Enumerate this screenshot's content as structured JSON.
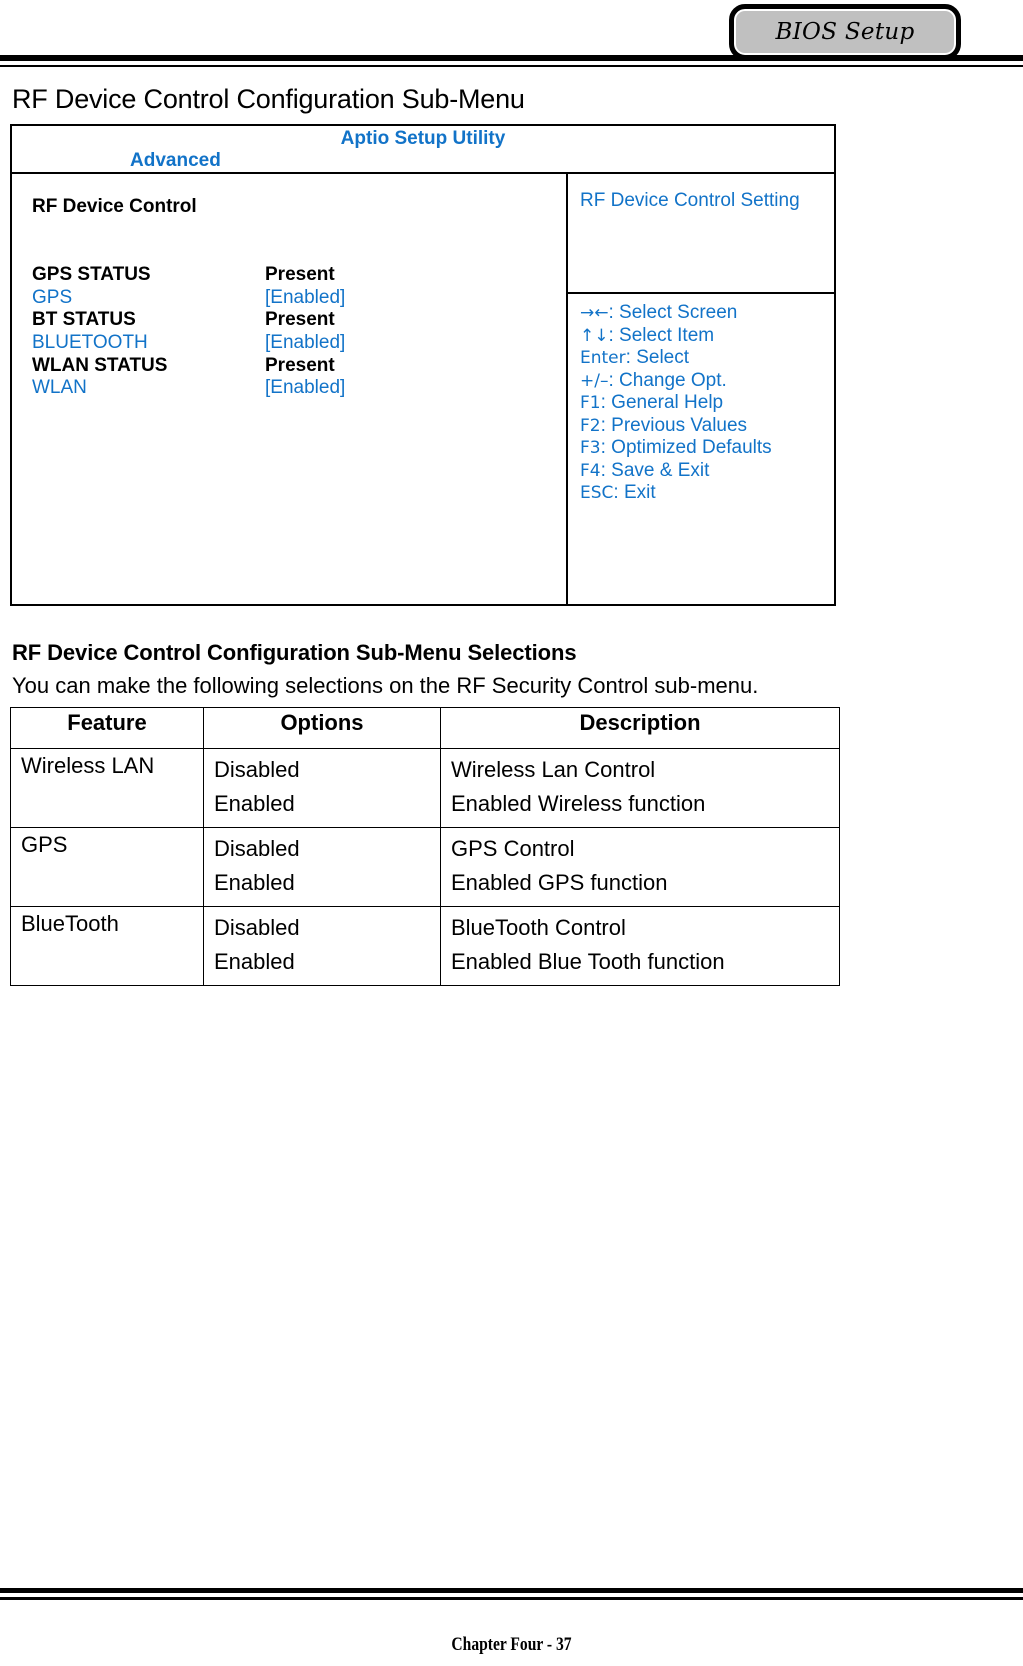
{
  "header": {
    "tab_label": "BIOS Setup"
  },
  "page_title": "RF Device Control Configuration Sub-Menu",
  "bios_screen": {
    "utility_title": "Aptio Setup Utility",
    "active_menu": "Advanced",
    "section_heading": "RF Device Control",
    "settings": [
      {
        "label": "GPS STATUS",
        "value": "Present",
        "kind": "status"
      },
      {
        "label": "GPS",
        "value": "[Enabled]",
        "kind": "option"
      },
      {
        "label": "BT STATUS",
        "value": "Present",
        "kind": "status"
      },
      {
        "label": "BLUETOOTH",
        "value": "[Enabled]",
        "kind": "option"
      },
      {
        "label": "WLAN STATUS",
        "value": "Present",
        "kind": "status"
      },
      {
        "label": "WLAN",
        "value": "[Enabled]",
        "kind": "option"
      }
    ],
    "help_title": "RF Device Control Setting",
    "key_legend": [
      {
        "keys": "→←",
        "action": ": Select Screen"
      },
      {
        "keys": "↑↓",
        "action": ": Select Item"
      },
      {
        "keys": "Enter",
        "action": ": Select"
      },
      {
        "keys": "+/–",
        "action": ": Change Opt."
      },
      {
        "keys": "F1",
        "action": ": General Help"
      },
      {
        "keys": "F2",
        "action": ": Previous Values"
      },
      {
        "keys": "F3",
        "action": ": Optimized Defaults"
      },
      {
        "keys": "F4",
        "action": ": Save & Exit"
      },
      {
        "keys": "ESC",
        "action": ": Exit"
      }
    ],
    "accent_color": "#1273c8"
  },
  "selections": {
    "heading": "RF Device Control Configuration Sub-Menu Selections",
    "intro": "You can make the following selections on the RF Security Control sub-menu.",
    "columns": [
      "Feature",
      "Options",
      "Description"
    ],
    "rows": [
      {
        "feature": "Wireless LAN",
        "options": [
          "Disabled",
          "Enabled"
        ],
        "descriptions": [
          "Wireless Lan Control",
          "Enabled Wireless function"
        ]
      },
      {
        "feature": "GPS",
        "options": [
          "Disabled",
          "Enabled"
        ],
        "descriptions": [
          "GPS Control",
          "Enabled GPS function"
        ]
      },
      {
        "feature": "BlueTooth",
        "options": [
          "Disabled",
          "Enabled"
        ],
        "descriptions": [
          "BlueTooth Control",
          "Enabled Blue Tooth function"
        ]
      }
    ]
  },
  "footer": {
    "chapter": "Chapter Four - 37"
  }
}
